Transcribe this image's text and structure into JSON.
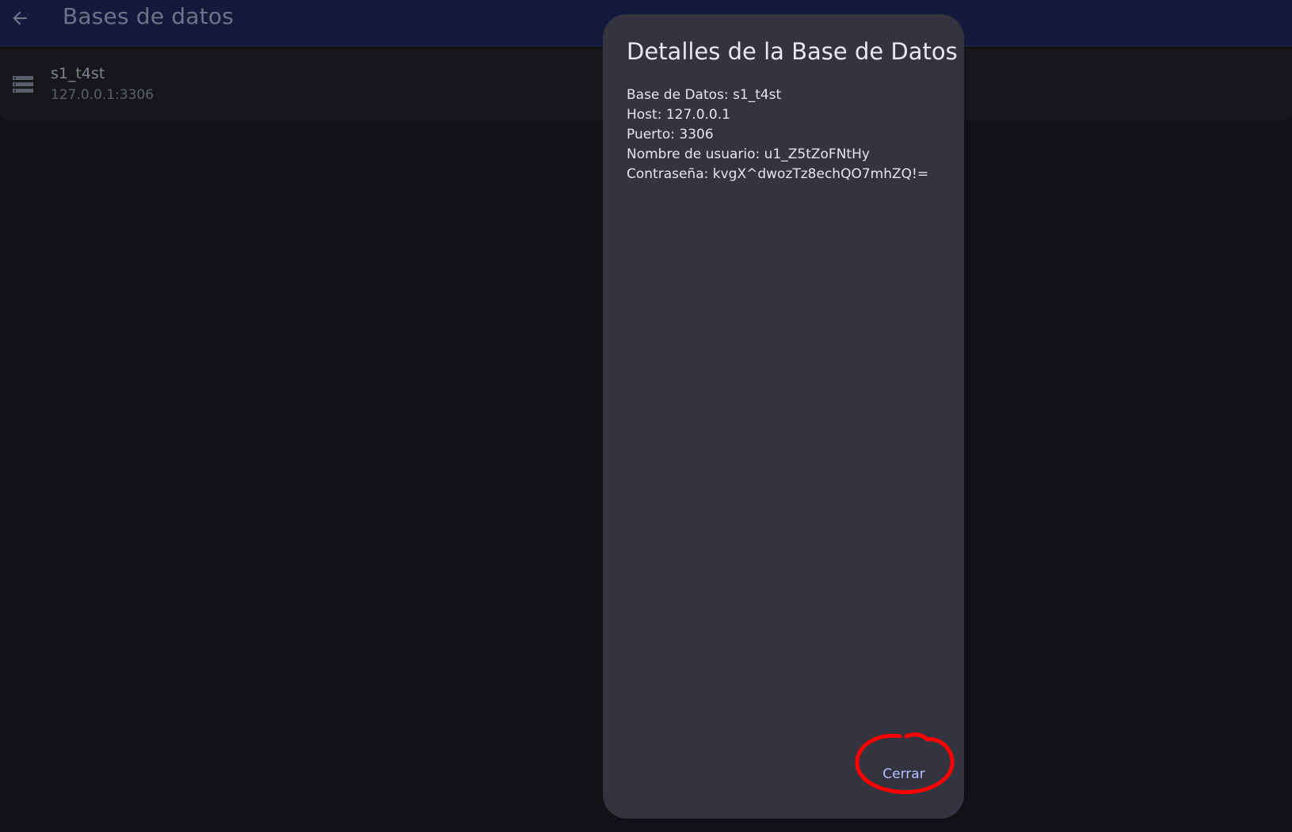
{
  "appbar": {
    "title": "Bases de datos",
    "back_icon": "arrow-left-icon"
  },
  "list": {
    "items": [
      {
        "icon": "database-list-icon",
        "name": "s1_t4st",
        "address": "127.0.0.1:3306"
      }
    ]
  },
  "dialog": {
    "title": "Detalles de la Base de Datos",
    "lines": {
      "database": "Base de Datos: s1_t4st",
      "host": "Host: 127.0.0.1",
      "port": "Puerto: 3306",
      "username": "Nombre de usuario: u1_Z5tZoFNtHy",
      "password": "Contraseña: kvgX^dwozTz8echQO7mhZQ!="
    },
    "close_label": "Cerrar"
  },
  "colors": {
    "appbar_bg": "#141a3c",
    "dialog_bg": "#33343f",
    "button_text": "#b9c0ff",
    "annotation": "#ff0000"
  }
}
